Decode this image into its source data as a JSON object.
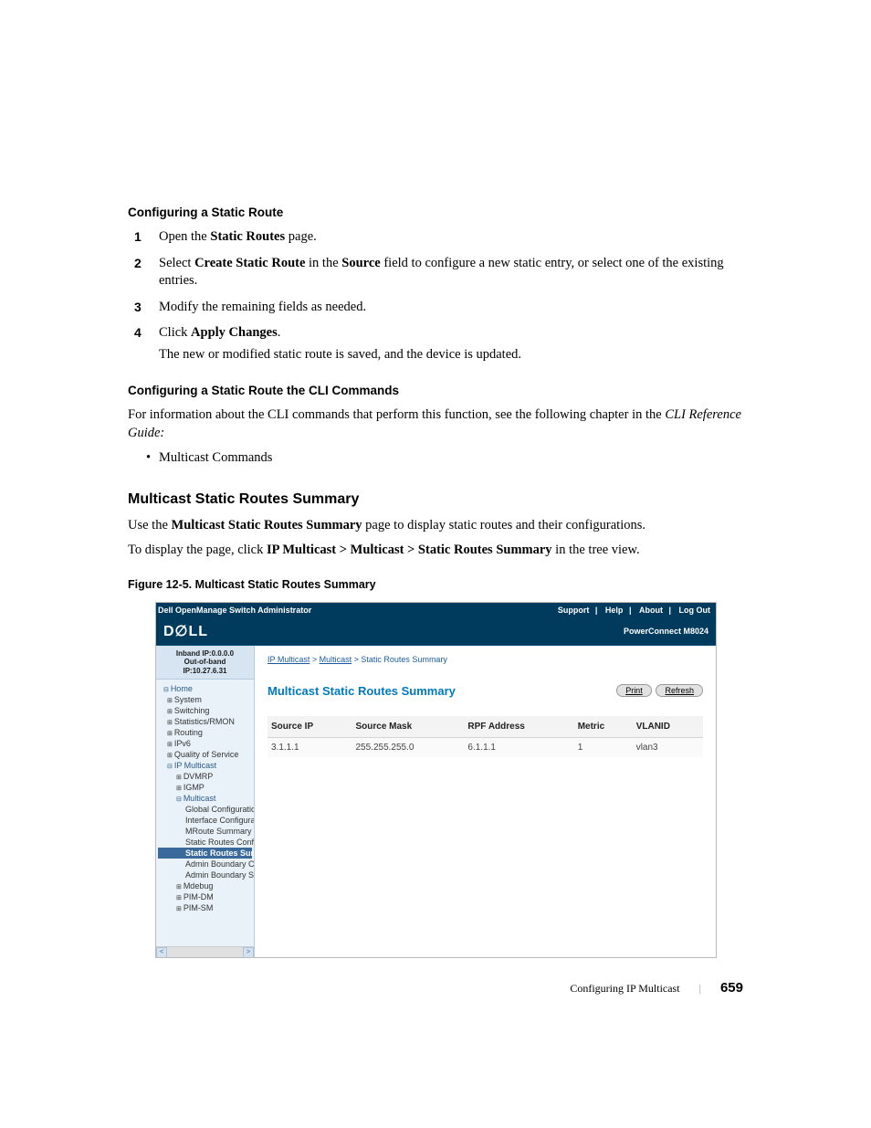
{
  "sections": {
    "configStatic": {
      "heading": "Configuring a Static Route",
      "steps": [
        {
          "num": "1",
          "prefix": "Open the ",
          "bold": "Static Routes",
          "suffix": " page."
        },
        {
          "num": "2",
          "prefix": "Select ",
          "bold": "Create Static Route",
          "mid": " in the ",
          "bold2": "Source",
          "suffix": " field to configure a new static entry, or select one of the existing entries."
        },
        {
          "num": "3",
          "prefix": "Modify the remaining fields as needed.",
          "bold": "",
          "suffix": ""
        },
        {
          "num": "4",
          "prefix": "Click ",
          "bold": "Apply Changes",
          "suffix": ".",
          "result": "The new or modified static route is saved, and the device is updated."
        }
      ],
      "cliHeading": "Configuring a Static Route the CLI Commands",
      "cliBody1": "For information about the CLI commands that perform this function, see the following chapter in the ",
      "cliBodyItalic": "CLI Reference Guide:",
      "cliBullet": "Multicast Commands"
    },
    "summary": {
      "heading": "Multicast Static Routes Summary",
      "body1a": "Use the ",
      "body1b": "Multicast Static Routes Summary",
      "body1c": " page to display static routes and their configurations.",
      "body2a": "To display the page, click ",
      "body2b": "IP Multicast > Multicast > Static Routes Summary",
      "body2c": " in the tree view.",
      "figCaption": "Figure 12-5.    Multicast Static Routes Summary"
    }
  },
  "screenshot": {
    "topbarTitle": "Dell OpenManage Switch Administrator",
    "topLinks": {
      "support": "Support",
      "help": "Help",
      "about": "About",
      "logout": "Log Out"
    },
    "model": "PowerConnect M8024",
    "ipInfo": {
      "inband": "Inband IP:0.0.0.0",
      "oob": "Out-of-band IP:10.27.6.31"
    },
    "tree": {
      "home": "Home",
      "system": "System",
      "switching": "Switching",
      "stats": "Statistics/RMON",
      "routing": "Routing",
      "ipv6": "IPv6",
      "qos": "Quality of Service",
      "ipmulti": "IP Multicast",
      "dvmrp": "DVMRP",
      "igmp": "IGMP",
      "multicast": "Multicast",
      "globalConfig": "Global Configuration",
      "ifaceConfig": "Interface Configuration",
      "mroute": "MRoute Summary",
      "staticConfig": "Static Routes Configu",
      "staticSumm": "Static Routes Summ",
      "adminBoundCon": "Admin Boundary Con",
      "adminBoundSum": "Admin Boundary Sum",
      "mdebug": "Mdebug",
      "pimdm": "PIM-DM",
      "pimsm": "PIM-SM"
    },
    "breadcrumb": {
      "a": "IP Multicast",
      "b": "Multicast",
      "c": "Static Routes Summary"
    },
    "panelTitle": "Multicast Static Routes Summary",
    "buttons": {
      "print": "Print",
      "refresh": "Refresh"
    },
    "table": {
      "headers": {
        "sourceIp": "Source IP",
        "sourceMask": "Source Mask",
        "rpfAddress": "RPF Address",
        "metric": "Metric",
        "vlanid": "VLANID"
      },
      "row": {
        "sourceIp": "3.1.1.1",
        "sourceMask": "255.255.255.0",
        "rpfAddress": "6.1.1.1",
        "metric": "1",
        "vlanid": "vlan3"
      }
    }
  },
  "footer": {
    "chapter": "Configuring IP Multicast",
    "page": "659"
  }
}
